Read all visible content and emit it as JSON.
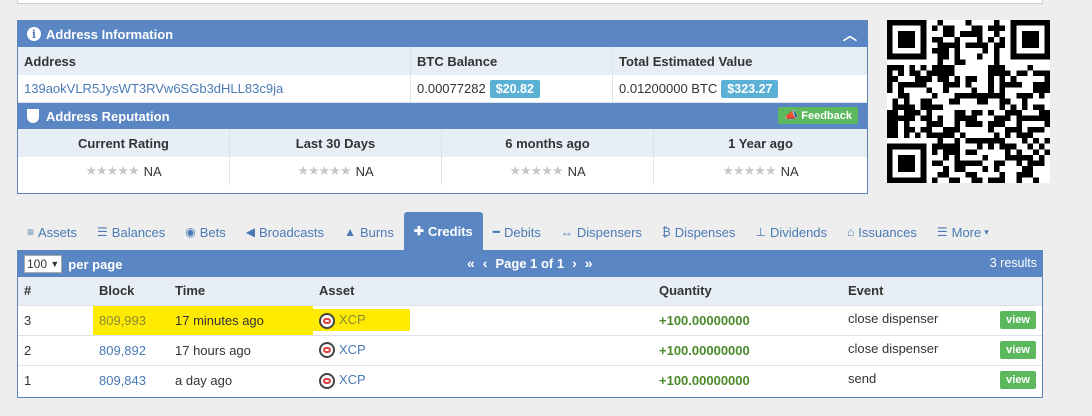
{
  "address_panel": {
    "title": "Address Information",
    "headers": {
      "address": "Address",
      "btc_balance": "BTC Balance",
      "total_value": "Total Estimated Value"
    },
    "address": "139aokVLR5JysWT3RVw6SGb3dHLL83c9ja",
    "btc_balance": "0.00077282",
    "btc_balance_usd": "$20.82",
    "total_value": "0.01200000 BTC",
    "total_value_usd": "$323.27"
  },
  "reputation": {
    "title": "Address Reputation",
    "feedback_label": "Feedback",
    "columns": [
      {
        "label": "Current Rating",
        "value": "NA"
      },
      {
        "label": "Last 30 Days",
        "value": "NA"
      },
      {
        "label": "6 months ago",
        "value": "NA"
      },
      {
        "label": "1 Year ago",
        "value": "NA"
      }
    ]
  },
  "tabs": [
    {
      "label": "Assets",
      "icon": "database-icon",
      "glyph": "≡"
    },
    {
      "label": "Balances",
      "icon": "list-icon",
      "glyph": "☰"
    },
    {
      "label": "Bets",
      "icon": "target-icon",
      "glyph": "◉"
    },
    {
      "label": "Broadcasts",
      "icon": "bullhorn-icon",
      "glyph": "📢"
    },
    {
      "label": "Burns",
      "icon": "fire-icon",
      "glyph": "🔥"
    },
    {
      "label": "Credits",
      "icon": "plus-icon",
      "glyph": "✚"
    },
    {
      "label": "Debits",
      "icon": "minus-icon",
      "glyph": "━"
    },
    {
      "label": "Dispensers",
      "icon": "arrows-icon",
      "glyph": "↔"
    },
    {
      "label": "Dispenses",
      "icon": "bitcoin-icon",
      "glyph": "₿"
    },
    {
      "label": "Dividends",
      "icon": "sitemap-icon",
      "glyph": "⊥"
    },
    {
      "label": "Issuances",
      "icon": "bank-icon",
      "glyph": "🏛"
    },
    {
      "label": "More",
      "icon": "list-icon",
      "glyph": "☰"
    }
  ],
  "active_tab": "Credits",
  "credits": {
    "per_page_value": "100",
    "per_page_label": "per page",
    "page_label": "Page 1 of 1",
    "results_label": "3 results",
    "columns": [
      "#",
      "Block",
      "Time",
      "Asset",
      "Quantity",
      "Event"
    ],
    "view_label": "view",
    "rows": [
      {
        "num": "3",
        "block": "809,993",
        "time": "17 minutes ago",
        "asset": "XCP",
        "quantity": "+100.00000000",
        "event": "close dispenser",
        "highlighted": true
      },
      {
        "num": "2",
        "block": "809,892",
        "time": "17 hours ago",
        "asset": "XCP",
        "quantity": "+100.00000000",
        "event": "close dispenser",
        "highlighted": false
      },
      {
        "num": "1",
        "block": "809,843",
        "time": "a day ago",
        "asset": "XCP",
        "quantity": "+100.00000000",
        "event": "send",
        "highlighted": false
      }
    ]
  },
  "colors": {
    "panel_header": "#5b86c4",
    "link": "#4a7ab5",
    "usd_badge": "#5bb0d6",
    "success": "#5cb85c",
    "highlight": "#ffeb00",
    "quantity": "#4a8a2a"
  }
}
